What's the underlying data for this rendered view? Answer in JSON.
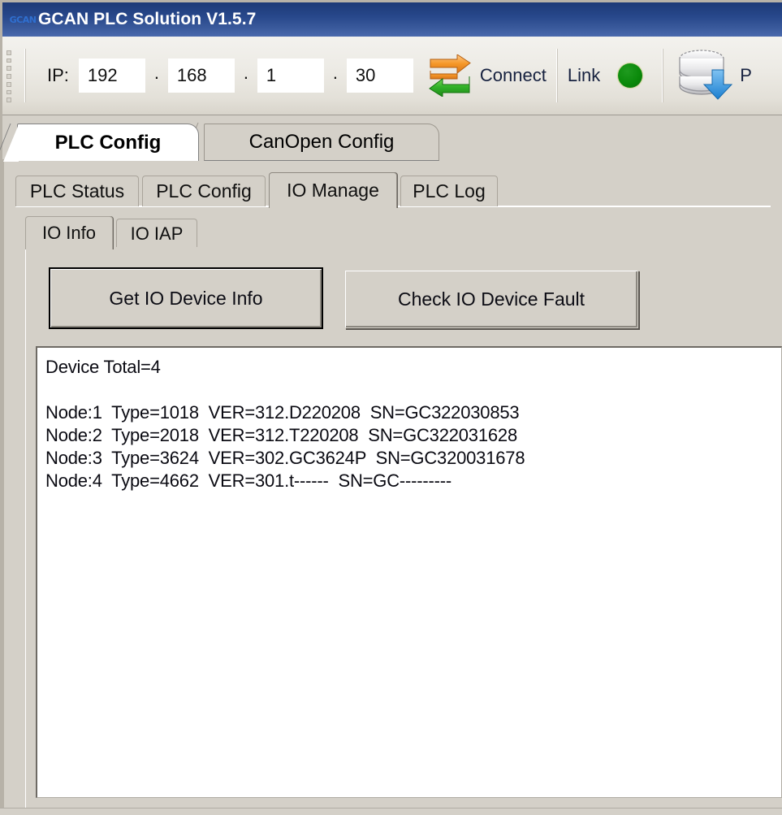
{
  "window": {
    "title": "GCAN PLC Solution V1.5.7",
    "icon": "gcan-logo-icon",
    "icon_text": "GCAN"
  },
  "toolbar": {
    "ip_label": "IP:",
    "ip_octets": [
      "192",
      "168",
      "1",
      "30"
    ],
    "ip_separator": ".",
    "connect_label": "Connect",
    "connect_icon": "sync-arrows-icon",
    "link_label": "Link",
    "link_status_color": "#0b8a0b",
    "download_icon": "database-download-icon",
    "truncated_label": "P"
  },
  "main_tabs": [
    {
      "label": "PLC Config",
      "active": true
    },
    {
      "label": "CanOpen Config",
      "active": false
    }
  ],
  "sub_tabs": [
    {
      "label": "PLC Status",
      "active": false
    },
    {
      "label": "PLC Config",
      "active": false
    },
    {
      "label": "IO Manage",
      "active": true
    },
    {
      "label": "PLC Log",
      "active": false
    }
  ],
  "sub_tabs2": [
    {
      "label": "IO Info",
      "active": true
    },
    {
      "label": "IO IAP",
      "active": false
    }
  ],
  "buttons": {
    "get_io_device_info": "Get IO Device Info",
    "check_io_device_fault": "Check IO Device Fault"
  },
  "log": {
    "device_total_line": "Device Total=4",
    "lines": [
      "Node:1  Type=1018  VER=312.D220208  SN=GC322030853",
      "Node:2  Type=2018  VER=312.T220208  SN=GC322031628",
      "Node:3  Type=3624  VER=302.GC3624P  SN=GC320031678",
      "Node:4  Type=4662  VER=301.t------  SN=GC---------"
    ],
    "text": "Device Total=4\n\nNode:1  Type=1018  VER=312.D220208  SN=GC322030853\nNode:2  Type=2018  VER=312.T220208  SN=GC322031628\nNode:3  Type=3624  VER=302.GC3624P  SN=GC320031678\nNode:4  Type=4662  VER=301.t------  SN=GC---------"
  },
  "colors": {
    "titlebar": "#27478a",
    "window_face": "#d4d0c8",
    "toolbar": "#eceae4",
    "led_green": "#0b8a0b",
    "text": "#0a0a12"
  }
}
